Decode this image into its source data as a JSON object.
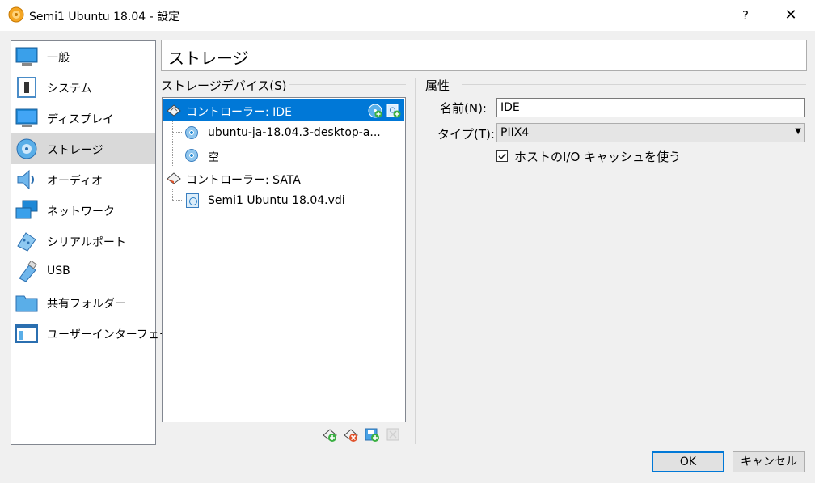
{
  "window": {
    "title": "Semi1 Ubuntu 18.04 - 設定",
    "help_label": "?",
    "close_label": "✕"
  },
  "sidebar": {
    "items": [
      {
        "label": "一般",
        "icon": "monitor-icon"
      },
      {
        "label": "システム",
        "icon": "chip-icon"
      },
      {
        "label": "ディスプレイ",
        "icon": "display-icon"
      },
      {
        "label": "ストレージ",
        "icon": "storage-icon",
        "selected": true
      },
      {
        "label": "オーディオ",
        "icon": "speaker-icon"
      },
      {
        "label": "ネットワーク",
        "icon": "network-icon"
      },
      {
        "label": "シリアルポート",
        "icon": "serial-port-icon"
      },
      {
        "label": "USB",
        "icon": "usb-icon"
      },
      {
        "label": "共有フォルダー",
        "icon": "folder-icon"
      },
      {
        "label": "ユーザーインターフェース",
        "icon": "ui-icon"
      }
    ]
  },
  "page_title": "ストレージ",
  "storage": {
    "group_title": "ストレージデバイス(S)",
    "tree": [
      {
        "label": "コントローラー: IDE",
        "type": "controller",
        "selected": true
      },
      {
        "label": "ubuntu-ja-18.04.3-desktop-a...",
        "type": "optical"
      },
      {
        "label": "空",
        "type": "optical"
      },
      {
        "label": "コントローラー: SATA",
        "type": "controller"
      },
      {
        "label": "Semi1 Ubuntu 18.04.vdi",
        "type": "hdd"
      }
    ],
    "controller_buttons": [
      "add-optical-drive-icon",
      "add-hard-disk-icon"
    ],
    "bottom_buttons": [
      "add-controller-icon",
      "remove-controller-icon",
      "add-attachment-icon",
      "remove-attachment-icon"
    ]
  },
  "attributes": {
    "group_title": "属性",
    "name_label": "名前(N):",
    "name_value": "IDE",
    "type_label": "タイプ(T):",
    "type_value": "PIIX4",
    "hostio_label": "ホストのI/O キャッシュを使う",
    "hostio_checked": true
  },
  "buttons": {
    "ok": "OK",
    "cancel": "キャンセル"
  }
}
